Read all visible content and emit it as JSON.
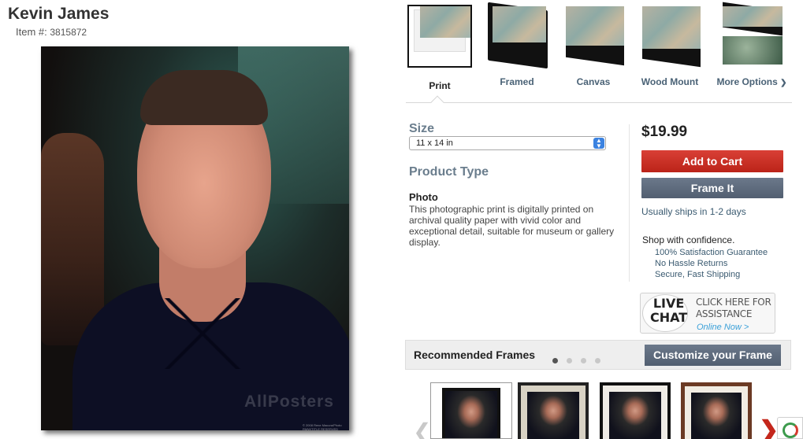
{
  "product": {
    "title": "Kevin James",
    "item_label": "Item #:",
    "item_number": "3815872",
    "image_watermark": "AllPosters",
    "image_copyright": "© 2008 Rene Macura/Photo RMW/TITLE RESERVED"
  },
  "format_options": [
    {
      "label": "Print",
      "selected": true
    },
    {
      "label": "Framed",
      "selected": false
    },
    {
      "label": "Canvas",
      "selected": false
    },
    {
      "label": "Wood Mount",
      "selected": false
    },
    {
      "label": "More Options",
      "selected": false
    }
  ],
  "size": {
    "heading": "Size",
    "selected": "11 x 14 in"
  },
  "product_type": {
    "heading": "Product Type",
    "name": "Photo",
    "description": "This photographic print is digitally printed on archival quality paper with vivid color and exceptional detail, suitable for museum or gallery display."
  },
  "purchase": {
    "price": "$19.99",
    "add_to_cart": "Add to Cart",
    "frame_it": "Frame It",
    "shipping": "Usually ships in 1-2 days",
    "confidence_heading": "Shop with confidence.",
    "guarantees": [
      "100% Satisfaction Guarantee",
      "No Hassle Returns",
      "Secure, Fast Shipping"
    ]
  },
  "live_chat": {
    "line1": "LIVE",
    "line2": "CHAT",
    "assist_line1": "CLICK HERE FOR",
    "assist_line2": "ASSISTANCE",
    "online": "Online Now >"
  },
  "recommended": {
    "title": "Recommended Frames",
    "customize": "Customize your Frame",
    "page_count": 4,
    "active_page": 1
  },
  "colors": {
    "accent_red": "#c4271c",
    "button_slate": "#5c697b",
    "link_blue": "#3a5a70",
    "heading_gray": "#6a7d8d"
  },
  "icons": [
    "chevron-down-icon",
    "select-arrows-icon",
    "chevron-left-icon",
    "chevron-right-icon",
    "chat-bubble-icon",
    "status-badge-icon"
  ]
}
